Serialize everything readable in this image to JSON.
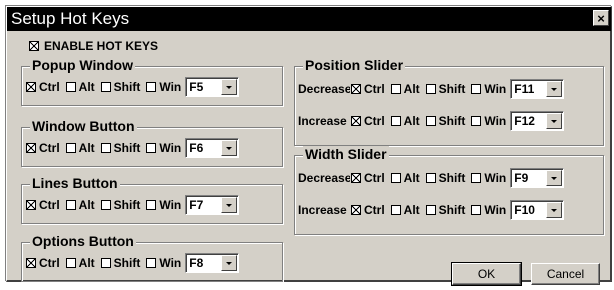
{
  "window": {
    "title": "Setup Hot Keys",
    "close_label": "×"
  },
  "enable": {
    "label": "ENABLE HOT KEYS",
    "checked": true
  },
  "mods": {
    "ctrl": "Ctrl",
    "alt": "Alt",
    "shift": "Shift",
    "win": "Win"
  },
  "groups": {
    "popup": {
      "title": "Popup Window",
      "ctrl": true,
      "alt": false,
      "shift": false,
      "win": false,
      "key": "F5"
    },
    "winbtn": {
      "title": "Window Button",
      "ctrl": true,
      "alt": false,
      "shift": false,
      "win": false,
      "key": "F6"
    },
    "lines": {
      "title": "Lines Button",
      "ctrl": true,
      "alt": false,
      "shift": false,
      "win": false,
      "key": "F7"
    },
    "options": {
      "title": "Options Button",
      "ctrl": true,
      "alt": false,
      "shift": false,
      "win": false,
      "key": "F8"
    },
    "position": {
      "title": "Position Slider",
      "decrease": {
        "label": "Decrease",
        "ctrl": true,
        "alt": false,
        "shift": false,
        "win": false,
        "key": "F11"
      },
      "increase": {
        "label": "Increase",
        "ctrl": true,
        "alt": false,
        "shift": false,
        "win": false,
        "key": "F12"
      }
    },
    "width": {
      "title": "Width Slider",
      "decrease": {
        "label": "Decrease",
        "ctrl": true,
        "alt": false,
        "shift": false,
        "win": false,
        "key": "F9"
      },
      "increase": {
        "label": "Increase",
        "ctrl": true,
        "alt": false,
        "shift": false,
        "win": false,
        "key": "F10"
      }
    }
  },
  "buttons": {
    "ok": "OK",
    "cancel": "Cancel"
  }
}
